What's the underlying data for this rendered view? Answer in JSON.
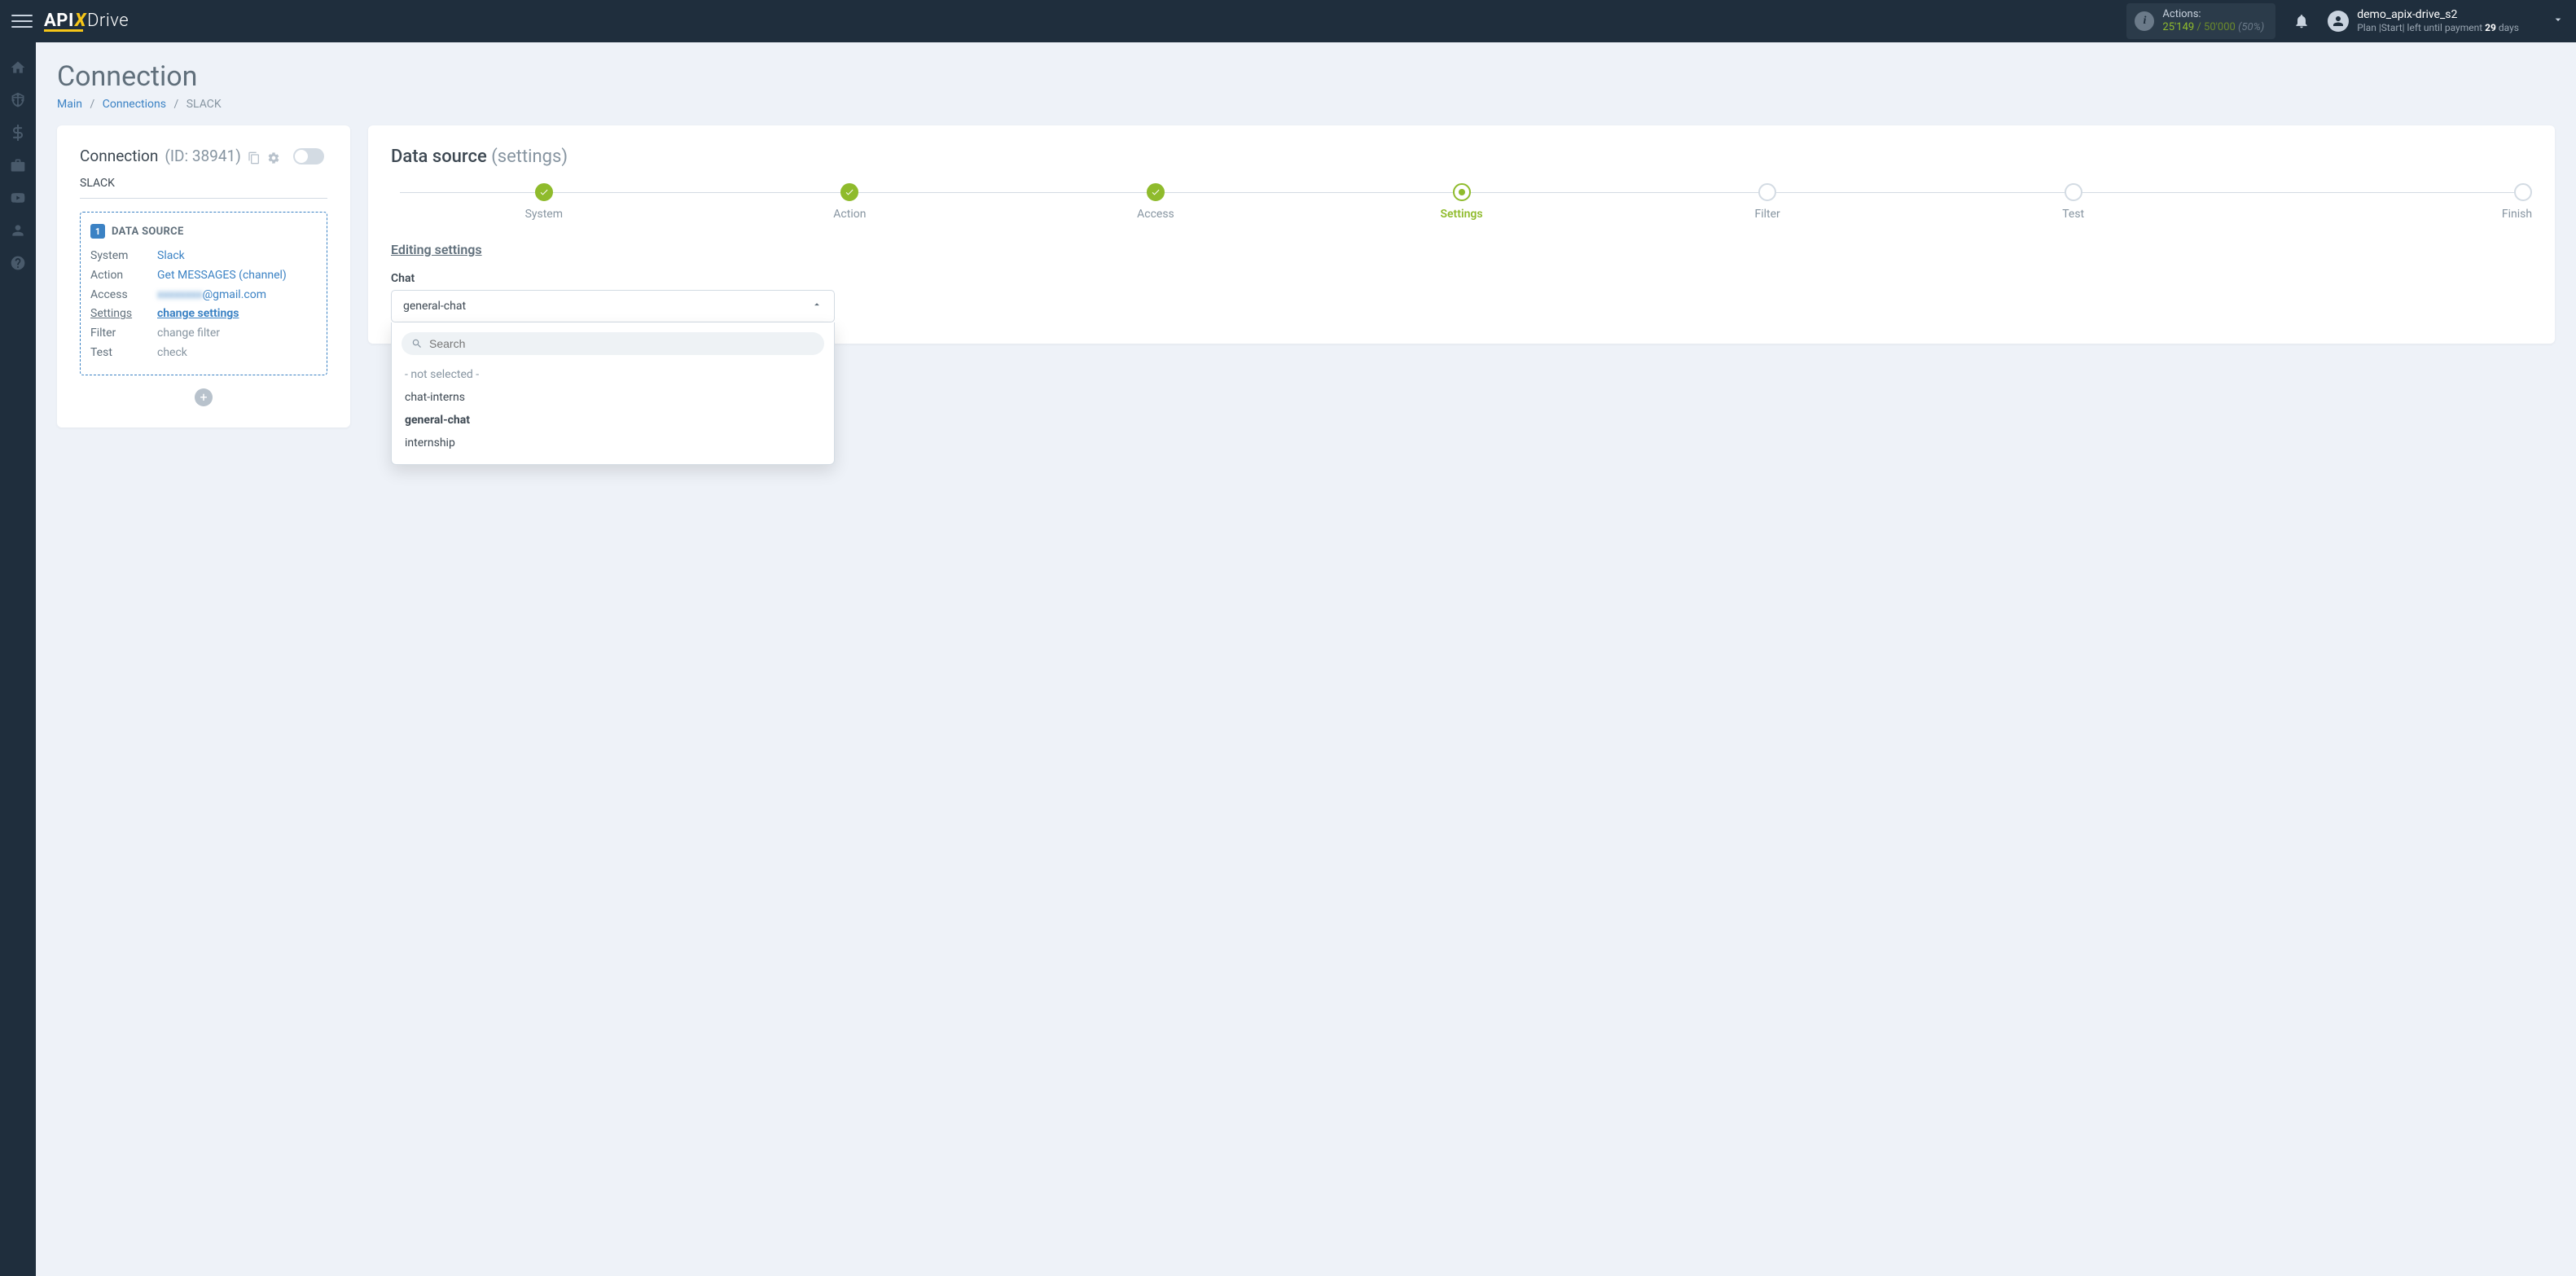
{
  "brand": {
    "part1": "API",
    "x": "X",
    "part2": "Drive"
  },
  "topbar": {
    "actions_label": "Actions:",
    "actions_used": "25'149",
    "actions_sep": " / ",
    "actions_total": "50'000",
    "actions_pct": "(50%)",
    "username": "demo_apix-drive_s2",
    "plan_prefix": "Plan |Start| left until payment ",
    "plan_days": "29",
    "plan_suffix": " days"
  },
  "page": {
    "title": "Connection",
    "crumb_main": "Main",
    "crumb_connections": "Connections",
    "crumb_current": "SLACK"
  },
  "left_card": {
    "title": "Connection",
    "id_label": "(ID: 38941)",
    "name": "SLACK",
    "ds_badge": "1",
    "ds_title": "DATA SOURCE",
    "rows": {
      "system": {
        "k": "System",
        "v": "Slack"
      },
      "action": {
        "k": "Action",
        "v": "Get MESSAGES (channel)"
      },
      "access": {
        "k": "Access",
        "v_blur": "xxxxxxxx",
        "v_tail": "@gmail.com"
      },
      "settings": {
        "k": "Settings",
        "v": "change settings"
      },
      "filter": {
        "k": "Filter",
        "v": "change filter"
      },
      "test": {
        "k": "Test",
        "v": "check"
      }
    },
    "add": "+"
  },
  "right_card": {
    "title": "Data source",
    "title_sub": "(settings)",
    "steps": [
      {
        "label": "System",
        "state": "done"
      },
      {
        "label": "Action",
        "state": "done"
      },
      {
        "label": "Access",
        "state": "done"
      },
      {
        "label": "Settings",
        "state": "current"
      },
      {
        "label": "Filter",
        "state": ""
      },
      {
        "label": "Test",
        "state": ""
      },
      {
        "label": "Finish",
        "state": ""
      }
    ],
    "section_title": "Editing settings",
    "field_label": "Chat",
    "select_value": "general-chat",
    "search_placeholder": "Search",
    "options": [
      {
        "label": "- not selected -",
        "cls": "placeholder"
      },
      {
        "label": "chat-interns",
        "cls": ""
      },
      {
        "label": "general-chat",
        "cls": "selected"
      },
      {
        "label": "internship",
        "cls": ""
      }
    ]
  }
}
